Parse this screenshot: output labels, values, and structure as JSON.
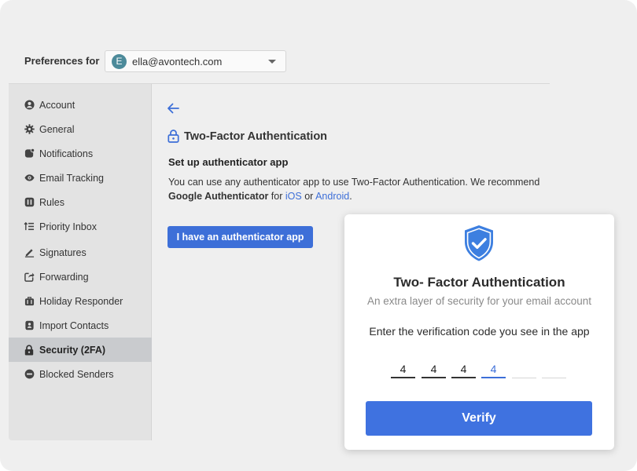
{
  "header": {
    "preferences_label": "Preferences for",
    "account": {
      "avatar_initial": "E",
      "email": "ella@avontech.com"
    }
  },
  "sidebar": {
    "items": [
      {
        "label": "Account",
        "icon": "account-icon"
      },
      {
        "label": "General",
        "icon": "gear-icon"
      },
      {
        "label": "Notifications",
        "icon": "notifications-icon"
      },
      {
        "label": "Email Tracking",
        "icon": "eye-icon"
      },
      {
        "label": "Rules",
        "icon": "rules-icon"
      },
      {
        "label": "Priority Inbox",
        "icon": "priority-icon"
      },
      {
        "label": "Signatures",
        "icon": "pen-icon"
      },
      {
        "label": "Forwarding",
        "icon": "forward-icon"
      },
      {
        "label": "Holiday Responder",
        "icon": "briefcase-icon"
      },
      {
        "label": "Import Contacts",
        "icon": "contacts-icon"
      },
      {
        "label": "Security (2FA)",
        "icon": "lock-icon",
        "active": true
      },
      {
        "label": "Blocked Senders",
        "icon": "block-icon"
      }
    ]
  },
  "main": {
    "section_title": "Two-Factor Authentication",
    "setup_title": "Set up authenticator app",
    "desc_part1": "You can use any authenticator app to use Two-Factor Authentication. We recommend ",
    "desc_bold": "Google Authenticator",
    "desc_part2": " for ",
    "ios_link": "iOS",
    "desc_part3": " or ",
    "android_link": "Android",
    "desc_part4": ".",
    "have_app_button": "I have an authenticator app"
  },
  "modal": {
    "title": "Two- Factor Authentication",
    "subtitle": "An extra layer of security for your email account",
    "instruction": "Enter the verification code you see in the app",
    "code_digits": [
      "4",
      "4",
      "4",
      "4",
      "",
      ""
    ],
    "verify_button": "Verify"
  },
  "colors": {
    "accent": "#3d6fd8",
    "active_sidebar_bg": "#c9cbce",
    "shield": "#3d7fe0"
  }
}
